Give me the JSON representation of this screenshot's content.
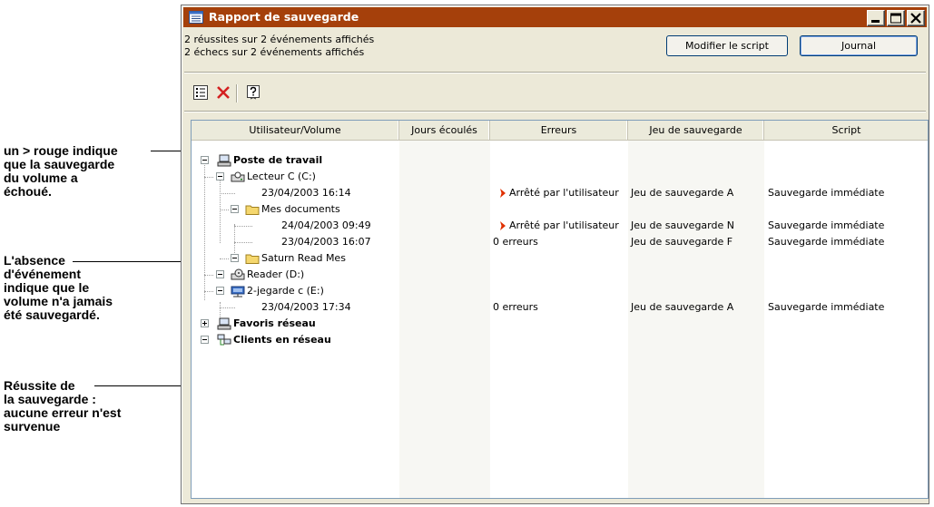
{
  "callouts": {
    "red_marker": [
      "un > rouge indique",
      "que la sauvegarde",
      "du volume a",
      "échoué."
    ],
    "no_event": [
      "L'absence",
      "d'événement",
      "indique que le",
      "volume n'a jamais",
      "été sauvegardé."
    ],
    "success": [
      "Réussite de",
      "la sauvegarde :",
      "aucune erreur n'est",
      "survenue"
    ]
  },
  "window": {
    "title": "Rapport de sauvegarde",
    "controls": [
      "minimize",
      "maximize",
      "close"
    ]
  },
  "summary": {
    "line1": "2 réussites sur 2 événements affichés",
    "line2": "2 échecs sur 2 événements affichés"
  },
  "buttons": {
    "modify_script": "Modifier le script",
    "journal": "Journal"
  },
  "toolbar": {
    "icons": [
      "details-icon",
      "delete-icon",
      "help-icon"
    ]
  },
  "table": {
    "columns": [
      "Utilisateur/Volume",
      "Jours écoulés",
      "Erreurs",
      "Jeu de sauvegarde",
      "Script"
    ],
    "rows": [
      {
        "label": "Poste de travail",
        "days": "",
        "errors": "",
        "set": "",
        "script": ""
      },
      {
        "label": "Lecteur C (C:)",
        "days": "",
        "errors": "",
        "set": "",
        "script": ""
      },
      {
        "label": "23/04/2003 16:14",
        "days": "",
        "errors": "Arrêté par l'utilisateur",
        "set": "Jeu de sauvegarde A",
        "script": "Sauvegarde immédiate"
      },
      {
        "label": "Mes documents",
        "days": "",
        "errors": "",
        "set": "",
        "script": ""
      },
      {
        "label": "24/04/2003 09:49",
        "days": "",
        "errors": "Arrêté par l'utilisateur",
        "set": "Jeu de sauvegarde N",
        "script": "Sauvegarde immédiate"
      },
      {
        "label": "23/04/2003 16:07",
        "days": "",
        "errors": "0 erreurs",
        "set": "Jeu de sauvegarde F",
        "script": "Sauvegarde immédiate"
      },
      {
        "label": "Saturn Read Mes",
        "days": "",
        "errors": "",
        "set": "",
        "script": ""
      },
      {
        "label": "Reader (D:)",
        "days": "",
        "errors": "",
        "set": "",
        "script": ""
      },
      {
        "label": "2-jegarde c (E:)",
        "days": "",
        "errors": "",
        "set": "",
        "script": ""
      },
      {
        "label": "23/04/2003 17:34",
        "days": "",
        "errors": "0 erreurs",
        "set": "Jeu de sauvegarde A",
        "script": "Sauvegarde immédiate"
      },
      {
        "label": "Favoris réseau",
        "days": "",
        "errors": "",
        "set": "",
        "script": ""
      },
      {
        "label": "Clients en réseau",
        "days": "",
        "errors": "",
        "set": "",
        "script": ""
      }
    ]
  },
  "colors": {
    "titlebar": "#a5400b",
    "error_marker": "#e03000",
    "folder": "#f5d76e"
  }
}
